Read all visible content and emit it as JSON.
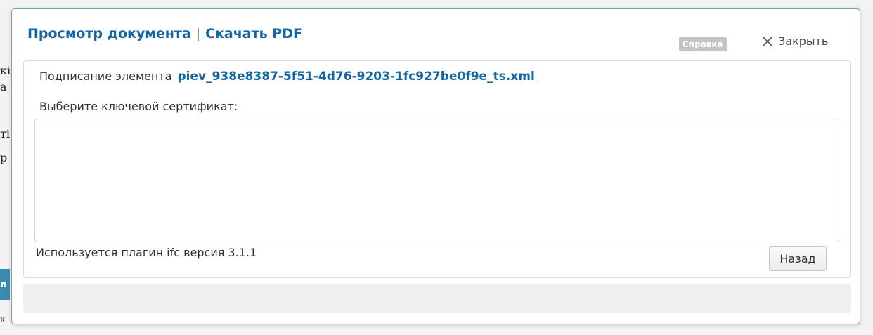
{
  "background": {
    "fragments": [
      "кі",
      "а",
      "ті",
      "р"
    ],
    "button_fragment": "л",
    "small_fragment": "к"
  },
  "header": {
    "view_link": "Просмотр документа",
    "separator": "|",
    "pdf_link": "Скачать PDF",
    "help_badge": "Справка",
    "close_label": "Закрыть"
  },
  "panel": {
    "sign_prefix": "Подписание элемента",
    "file_link": "piev_938e8387-5f51-4d76-9203-1fc927be0f9e_ts.xml",
    "choose_label": "Выберите ключевой сертификат:",
    "plugin_text": "Используется плагин ifc версия 3.1.1",
    "back_button": "Назад"
  },
  "colors": {
    "link": "#1565a3",
    "dialog_border": "#7aa79a",
    "badge_bg": "#c4c4c4"
  }
}
